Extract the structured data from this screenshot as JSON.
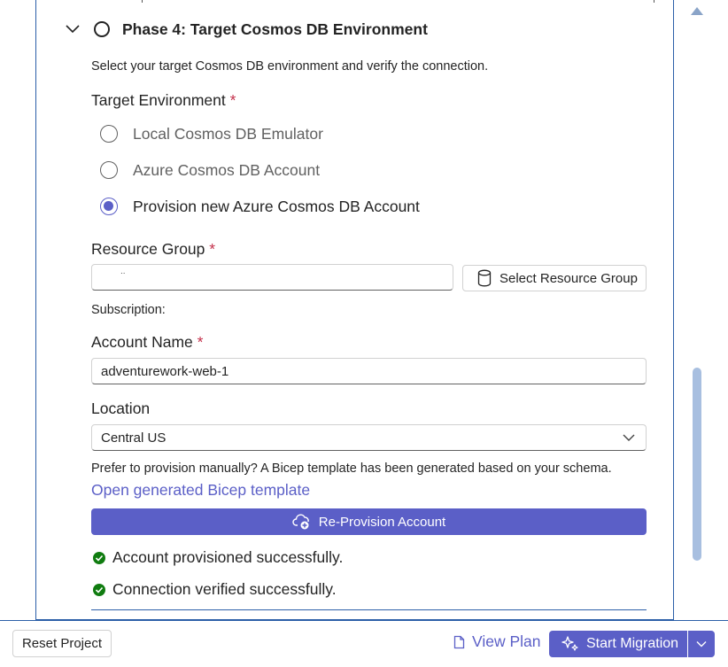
{
  "phase": {
    "title": "Phase 4: Target Cosmos DB Environment",
    "description": "Select your target Cosmos DB environment and verify the connection."
  },
  "target_env": {
    "label": "Target Environment",
    "required_mark": "*",
    "options": [
      {
        "label": "Local Cosmos DB Emulator",
        "selected": false
      },
      {
        "label": "Azure Cosmos DB Account",
        "selected": false
      },
      {
        "label": "Provision new Azure Cosmos DB Account",
        "selected": true
      }
    ]
  },
  "resource_group": {
    "label": "Resource Group",
    "required_mark": "*",
    "value": "..",
    "select_button": "Select Resource Group"
  },
  "subscription": {
    "label": "Subscription:"
  },
  "account_name": {
    "label": "Account Name",
    "required_mark": "*",
    "value": "adventurework-web-1"
  },
  "location": {
    "label": "Location",
    "value": "Central US"
  },
  "bicep": {
    "hint": "Prefer to provision manually? A Bicep template has been generated based on your schema.",
    "link": "Open generated Bicep template"
  },
  "reprovision_button": "Re-Provision Account",
  "status": [
    {
      "text": "Account provisioned successfully.",
      "state": "success"
    },
    {
      "text": "Connection verified successfully.",
      "state": "success"
    }
  ],
  "footer": {
    "reset_label": "Reset Project",
    "view_plan_label": "View Plan",
    "start_label": "Start Migration"
  },
  "colors": {
    "accent": "#5b5fc7",
    "success": "#107c10",
    "required": "#c4314b",
    "panel_border": "#2c5fa8"
  }
}
